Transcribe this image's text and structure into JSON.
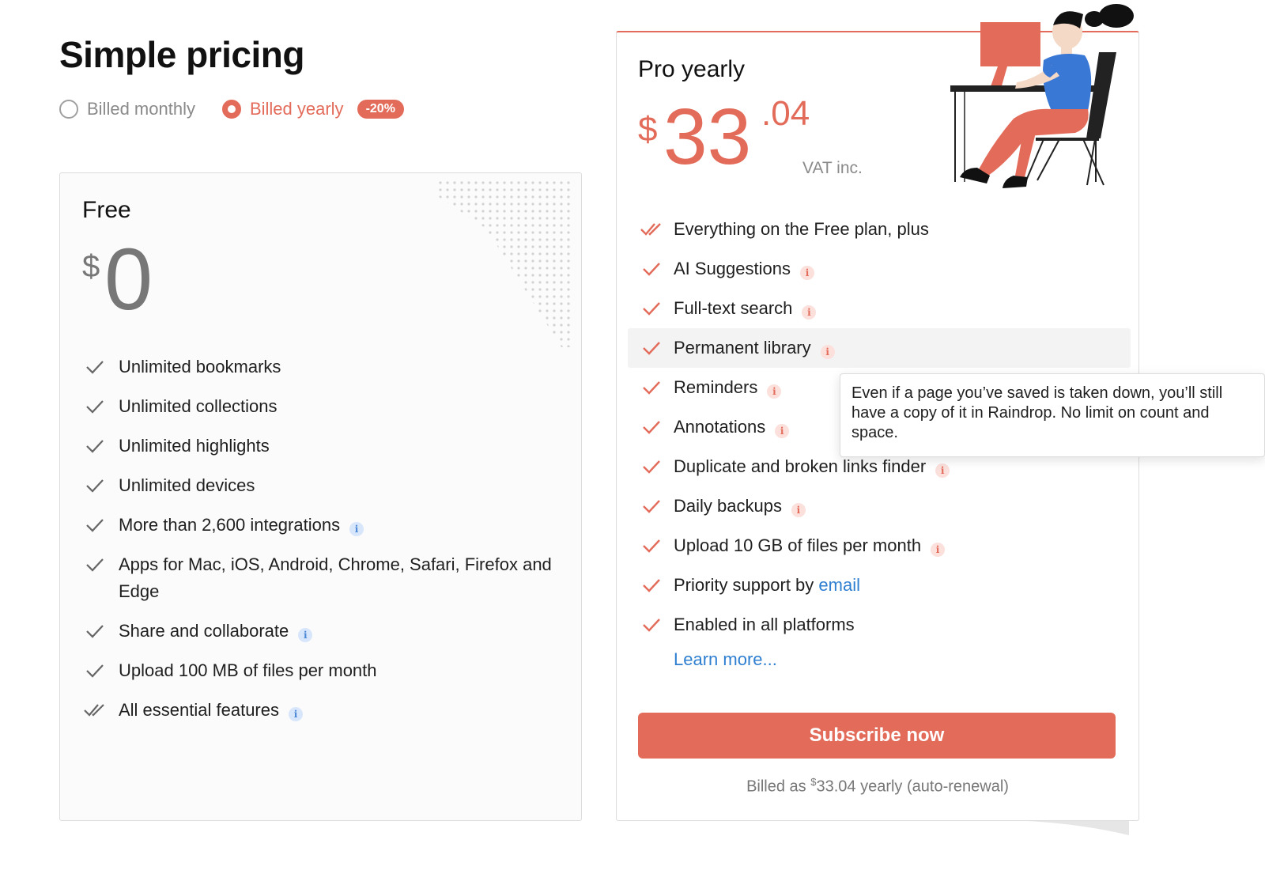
{
  "page": {
    "title": "Simple pricing"
  },
  "billing": {
    "monthly_label": "Billed monthly",
    "yearly_label": "Billed yearly",
    "discount_badge": "-20%",
    "selected": "yearly"
  },
  "free_plan": {
    "title": "Free",
    "currency": "$",
    "price": "0",
    "features": [
      {
        "text": "Unlimited bookmarks"
      },
      {
        "text": "Unlimited collections"
      },
      {
        "text": "Unlimited highlights"
      },
      {
        "text": "Unlimited devices"
      },
      {
        "text": "More than 2,600 integrations"
      },
      {
        "text": "Apps for Mac, iOS, Android, Chrome, Safari, Firefox and Edge"
      },
      {
        "text": "Share and collaborate"
      },
      {
        "text": "Upload 100 MB of files per month"
      },
      {
        "text": "All essential features"
      }
    ]
  },
  "pro_plan": {
    "title": "Pro yearly",
    "currency": "$",
    "price_whole": "33",
    "price_cents": ".04",
    "vat_note": "VAT inc.",
    "features": [
      {
        "text": "Everything on the Free plan, plus"
      },
      {
        "text": "AI Suggestions"
      },
      {
        "text": "Full-text search"
      },
      {
        "text": "Permanent library"
      },
      {
        "text": "Reminders"
      },
      {
        "text": "Annotations"
      },
      {
        "text": "Duplicate and broken links finder"
      },
      {
        "text": "Daily backups"
      },
      {
        "text": "Upload 10 GB of files per month"
      },
      {
        "text": "Priority support by",
        "link": "email"
      },
      {
        "text": "Enabled in all platforms"
      }
    ],
    "learn_more": "Learn more...",
    "subscribe_label": "Subscribe now",
    "billed_prefix": "Billed as",
    "billed_currency": "$",
    "billed_amount": "33.04 yearly (auto-renewal)"
  },
  "tooltip": {
    "text": "Even if a page you’ve saved is taken down, you’ll still have a copy of it in Raindrop. No limit on count and space."
  },
  "colors": {
    "accent": "#e36b5a",
    "link": "#2f7fd1",
    "info_blue": "#4a87d6",
    "card_bg": "#fbfbfb",
    "border": "#dcdcdc",
    "illustration_shirt": "#3a78d6"
  },
  "icons": {
    "check": "check-icon",
    "double_check": "double-check-icon",
    "info": "info-icon"
  }
}
